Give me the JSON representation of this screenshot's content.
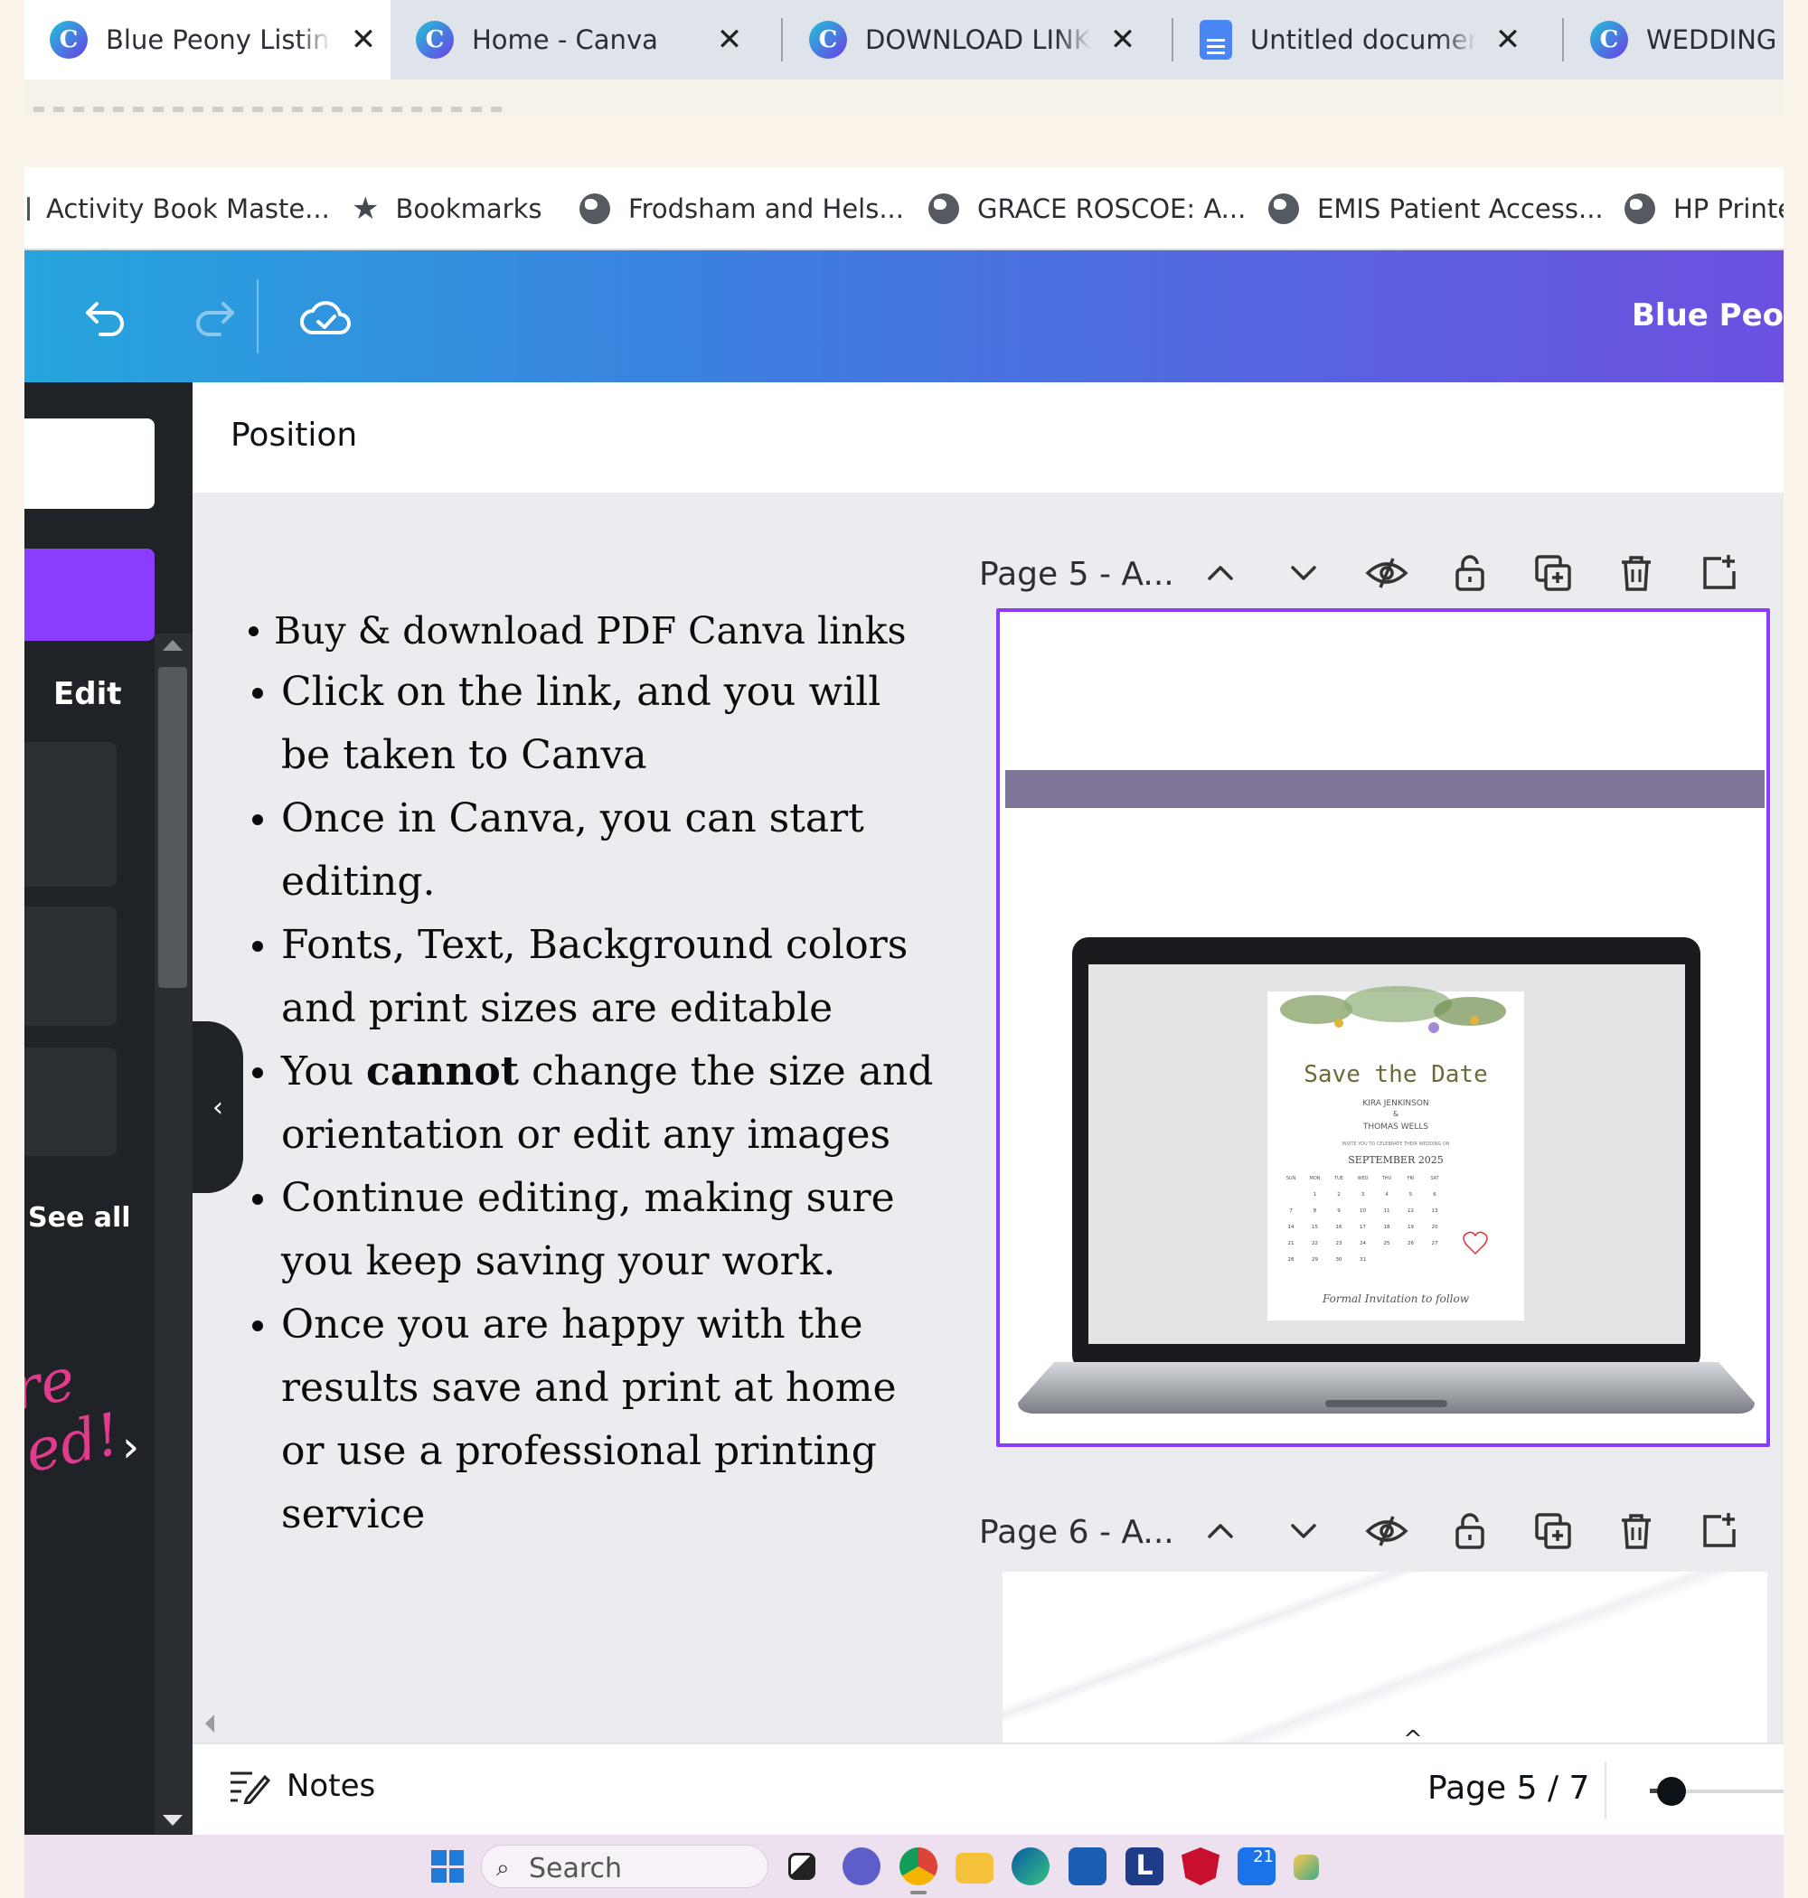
{
  "browser": {
    "tabs": [
      {
        "title": "Blue Peony Listing",
        "active": true,
        "favicon": "canva-icon"
      },
      {
        "title": "Home - Canva",
        "active": false,
        "favicon": "canva-icon"
      },
      {
        "title": "DOWNLOAD LINKS",
        "active": false,
        "favicon": "canva-icon"
      },
      {
        "title": "Untitled document",
        "active": false,
        "favicon": "google-docs-icon"
      },
      {
        "title": "WEDDING I",
        "active": false,
        "favicon": "canva-icon"
      }
    ],
    "close_glyph": "✕",
    "bookmarks": [
      {
        "label": "Activity Book Maste...",
        "icon": "folder-icon"
      },
      {
        "label": "Bookmarks",
        "icon": "star-icon"
      },
      {
        "label": "Frodsham and Hels...",
        "icon": "globe-icon"
      },
      {
        "label": "GRACE ROSCOE: A...",
        "icon": "globe-icon"
      },
      {
        "label": "EMIS Patient Access...",
        "icon": "globe-icon"
      },
      {
        "label": "HP Printe",
        "icon": "globe-icon"
      }
    ]
  },
  "canva": {
    "header": {
      "doc_name": "Blue Peon"
    },
    "rail": {
      "edit_label": "Edit",
      "see_all_label": "See all",
      "promo_text": "re\ned!"
    },
    "collapse_glyph": "‹",
    "panel_title": "Position",
    "instructions": [
      {
        "text": "Buy & download PDF Canva links"
      },
      {
        "text": "Click on the link, and you will be taken to Canva"
      },
      {
        "text": "Once in Canva, you can start editing."
      },
      {
        "text": " Fonts, Text, Background colors and print sizes are editable"
      },
      {
        "pre": "You ",
        "bold": "cannot",
        "post": " change the size and orientation or edit any images"
      },
      {
        "text": "Continue editing, making sure you keep saving your work."
      },
      {
        "text": "Once you are happy with the results save and print at home or use a professional printing service"
      }
    ],
    "pages": [
      {
        "label": "Page 5 - A...",
        "selected": true
      },
      {
        "label": "Page 6 - A...",
        "selected": false
      }
    ],
    "save_the_date": {
      "title": "Save the Date",
      "names_line1": "KIRA JENKINSON",
      "names_and": "&",
      "names_line2": "THOMAS WELLS",
      "invite_line": "INVITE YOU TO CELEBRATE THEIR WEDDING ON",
      "month": "SEPTEMBER 2025",
      "weekdays": [
        "SUN",
        "MON",
        "TUE",
        "WED",
        "THU",
        "FRI",
        "SAT"
      ],
      "days": [
        "",
        "1",
        "2",
        "3",
        "4",
        "5",
        "6",
        "7",
        "8",
        "9",
        "10",
        "11",
        "12",
        "13",
        "14",
        "15",
        "16",
        "17",
        "18",
        "19",
        "20",
        "21",
        "22",
        "23",
        "24",
        "25",
        "26",
        "27",
        "28",
        "29",
        "30",
        "31"
      ],
      "footer": "Formal Invitation to follow"
    },
    "footer": {
      "notes_label": "Notes",
      "page_count": "Page 5 / 7",
      "zoom_fraction": 0.15
    },
    "pullup_glyph": "^"
  },
  "taskbar": {
    "search_placeholder": "Search",
    "apps": [
      "task-view-icon",
      "chat-icon",
      "chrome-icon",
      "file-explorer-icon",
      "edge-icon",
      "store-icon",
      "l-app-icon",
      "mcafee-icon",
      "mail-icon",
      "photos-icon"
    ],
    "mail_badge": "21"
  },
  "colors": {
    "canva_purple": "#8b3dff",
    "header_gradient_start": "#26a6dd",
    "header_gradient_end": "#6c50e0",
    "rail_bg": "#1f2226",
    "stripe": "#7f7599"
  }
}
